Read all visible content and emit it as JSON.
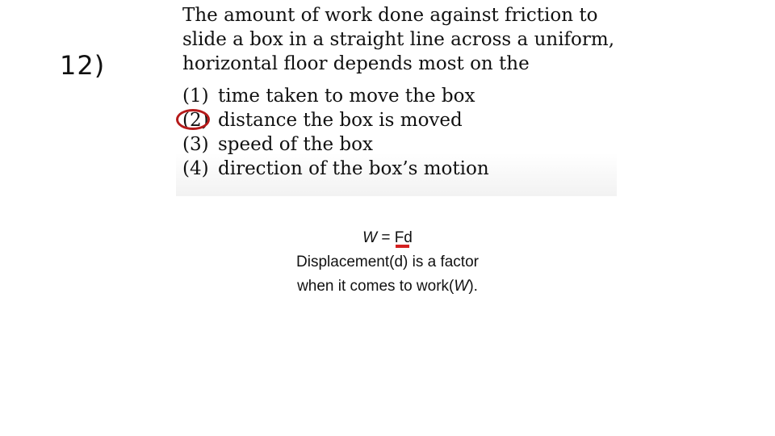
{
  "question_number": "12)",
  "question": {
    "stem_lines": [
      "The amount of work done against friction to",
      "slide a box in a straight line across a uniform,",
      "horizontal floor depends most on the"
    ],
    "options": [
      {
        "number": "(1)",
        "text": "time taken to move the box"
      },
      {
        "number": "(2)",
        "text": "distance the box is moved"
      },
      {
        "number": "(3)",
        "text": "speed of the box"
      },
      {
        "number": "(4)",
        "text": "direction of the box’s motion"
      }
    ],
    "selected_option": "(2)",
    "annotation_color": "#b51a1a"
  },
  "explanation": {
    "formula_var": "W",
    "formula_rest": " = Fd",
    "line2": "Displacement(d) is a factor",
    "line3_pre": "when it comes to work(",
    "line3_var": "W",
    "line3_post": ").",
    "underline_color": "#d42020"
  }
}
